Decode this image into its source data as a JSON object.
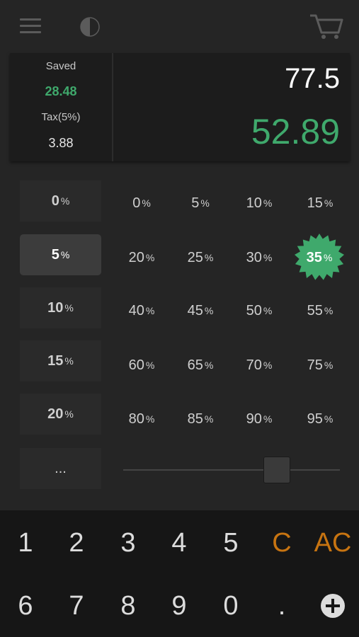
{
  "display": {
    "saved_label": "Saved",
    "saved_value": "28.48",
    "tax_label": "Tax(5%)",
    "tax_value": "3.88",
    "price": "77.5",
    "result": "52.89"
  },
  "tax_rates": [
    {
      "value": "0",
      "unit": "%"
    },
    {
      "value": "5",
      "unit": "%"
    },
    {
      "value": "10",
      "unit": "%"
    },
    {
      "value": "15",
      "unit": "%"
    },
    {
      "value": "20",
      "unit": "%"
    },
    {
      "value": "...",
      "unit": ""
    }
  ],
  "discounts": [
    [
      "0",
      "5",
      "10",
      "15"
    ],
    [
      "20",
      "25",
      "30",
      "35"
    ],
    [
      "40",
      "45",
      "50",
      "55"
    ],
    [
      "60",
      "65",
      "70",
      "75"
    ],
    [
      "80",
      "85",
      "90",
      "95"
    ]
  ],
  "discount_unit": "%",
  "keypad": {
    "row1": [
      "1",
      "2",
      "3",
      "4",
      "5",
      "C",
      "AC"
    ],
    "row2": [
      "6",
      "7",
      "8",
      "9",
      "0",
      ".",
      "plus-icon"
    ]
  },
  "selected_tax": "5",
  "selected_discount": "35",
  "slider_fraction": 0.74,
  "colors": {
    "accent_green": "#3fa96c",
    "accent_orange": "#c77411",
    "background": "#252525",
    "keypad_background": "#161616"
  }
}
